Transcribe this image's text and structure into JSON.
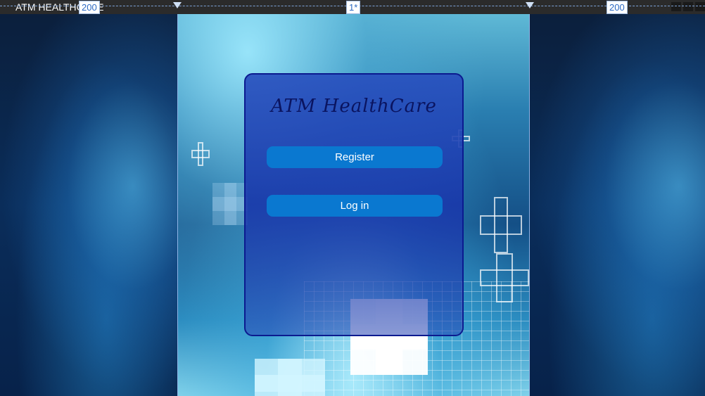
{
  "window": {
    "title": "ATM HEALTHCARE"
  },
  "designer": {
    "left_column": "200",
    "center_column": "1*",
    "right_column": "200"
  },
  "card": {
    "title": "ATM HealthCare",
    "register_label": "Register",
    "login_label": "Log in"
  },
  "colors": {
    "card_border": "#0b1a8f",
    "button": "#0a78d0",
    "title_text": "#0a1460"
  }
}
